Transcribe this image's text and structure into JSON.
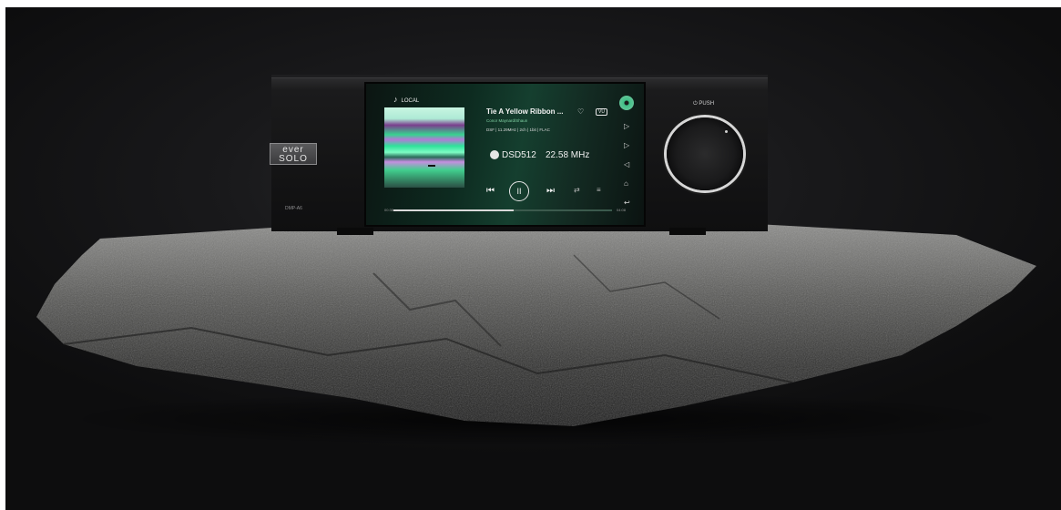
{
  "device": {
    "brand_logo_line1": "ever",
    "brand_logo_line2": "SOLO",
    "model": "DMP-A6",
    "knob_label": "PUSH"
  },
  "screen": {
    "source": "LOCAL",
    "track_title": "Tie A Yellow Ribbon ...",
    "artist": "Conor Maynard/Shaun",
    "meta": "DSF  |  11.29MHz  |  2ch  |  1bit  |  FLAC",
    "format": "DSD512",
    "rate": "22.58 MHz",
    "vu_label": "VU",
    "time_elapsed": "00:38",
    "time_total": "04:08",
    "progress": 0.55
  },
  "icons": {
    "music_note": "♪",
    "heart": "♡",
    "play": "▷",
    "next_side": "▷",
    "prev_side": "◁",
    "home": "⌂",
    "back": "↩",
    "prev": "⏮",
    "pause": "II",
    "next": "⏭",
    "repeat": "⇄",
    "list": "≡"
  },
  "colors": {
    "screen_green": "#153f2f",
    "accent": "#7fd0a2"
  }
}
